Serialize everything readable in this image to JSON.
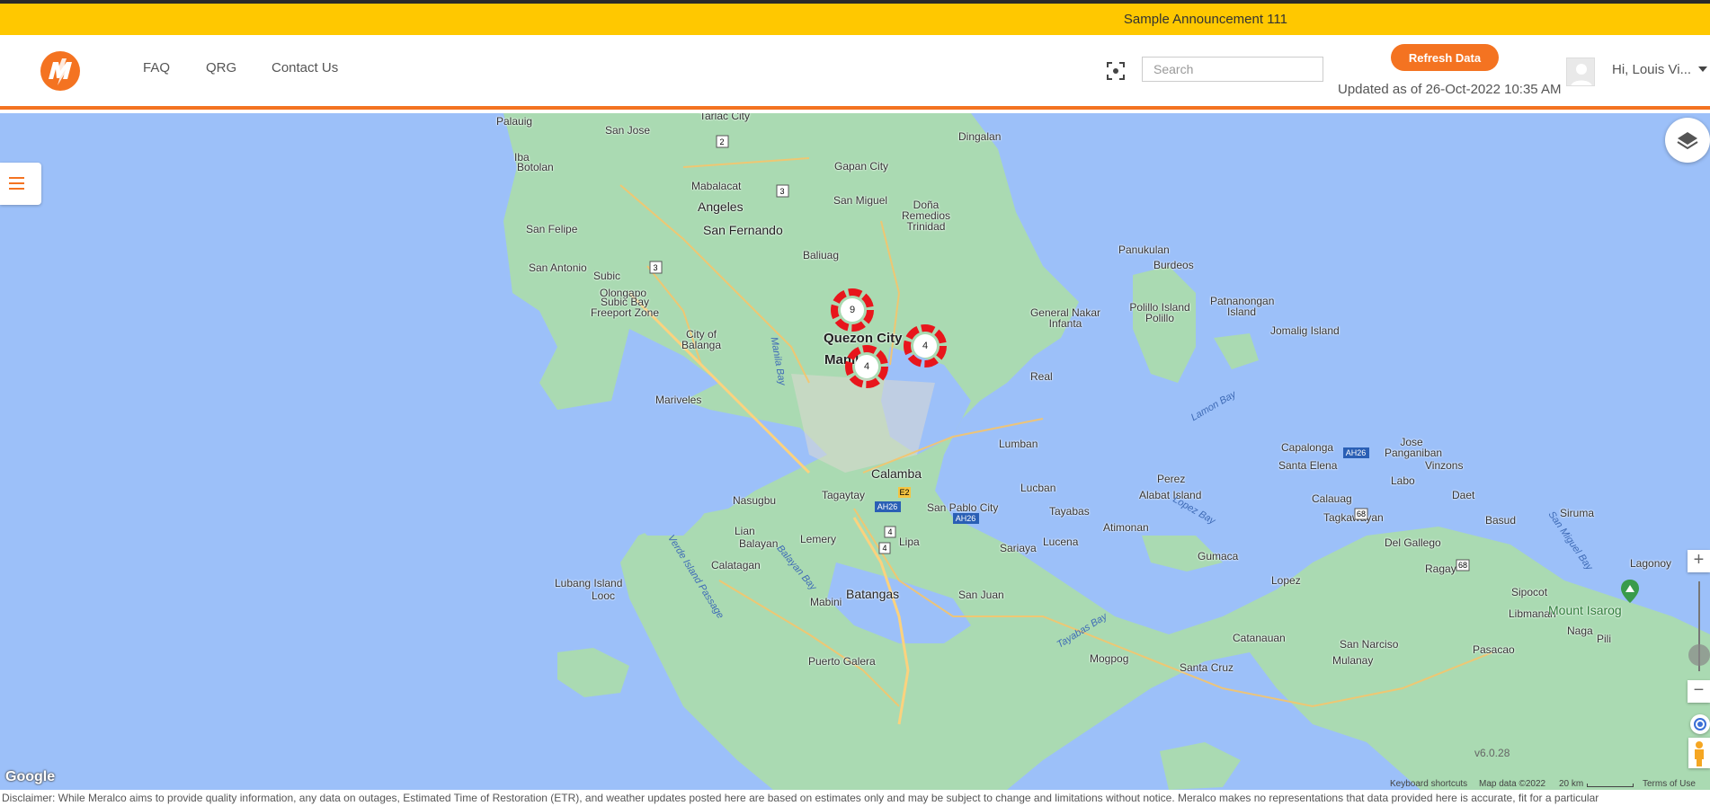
{
  "announcement": {
    "text": "Sample Announcement 111"
  },
  "header": {
    "nav": [
      {
        "label": "FAQ"
      },
      {
        "label": "QRG"
      },
      {
        "label": "Contact Us"
      }
    ],
    "search_placeholder": "Search",
    "refresh_label": "Refresh Data",
    "updated_text": "Updated as of 26-Oct-2022 10:35 AM",
    "user_greeting": "Hi, Louis Vi..."
  },
  "colors": {
    "brand_orange": "#f47321",
    "announcement_yellow": "#ffc800",
    "water": "#9cc0f9",
    "land": "#aadab2",
    "cluster_red": "#e8161c"
  },
  "map": {
    "labels": {
      "palauig": "Palauig",
      "tarlac": "Tarlac City",
      "san_jose": "San Jose",
      "dingalan": "Dingalan",
      "iba": "Iba",
      "botolan": "Botolan",
      "gapan": "Gapan City",
      "mabalacat": "Mabalacat",
      "angeles": "Angeles",
      "san_fernando": "San Fernando",
      "san_miguel": "San Miguel",
      "dona_remedios": "Doña Remedios Trinidad",
      "san_felipe": "San Felipe",
      "san_antonio": "San Antonio",
      "subic": "Subic",
      "olongapo": "Olongapo",
      "subic_bay": "Subic Bay Freeport Zone",
      "baliuag": "Baliuag",
      "panukulan": "Panukulan",
      "burdeos": "Burdeos",
      "polillo": "Polillo Island Polillo",
      "patnanongan": "Patnanongan Island",
      "jomalig": "Jomalig Island",
      "general_nakar": "General Nakar Infanta",
      "balanga": "City of Balanga",
      "quezon_city": "Quezon City",
      "manila": "Manila",
      "manila_bay": "Manila Bay",
      "real": "Real",
      "mariveles": "Mariveles",
      "lamon_bay": "Lamon Bay",
      "lumban": "Lumban",
      "calamba": "Calamba",
      "capalonga": "Capalonga",
      "jose_panganiban": "Jose Panganiban",
      "santa_elena": "Santa Elena",
      "vinzons": "Vinzons",
      "labo": "Labo",
      "daet": "Daet",
      "perez": "Perez",
      "alabat": "Alabat Island",
      "nasugbu": "Nasugbu",
      "tagaytay": "Tagaytay",
      "lucban": "Lucban",
      "calauag": "Calauag",
      "tagkawayan": "Tagkawayan",
      "basud": "Basud",
      "siruma": "Siruma",
      "san_pablo": "San Pablo City",
      "tayabas": "Tayabas",
      "lopez_bay": "Lopez Bay",
      "del_gallego": "Del Gallego",
      "lian": "Lian",
      "san_miguel_bay": "San Miguel Bay",
      "lagonoy": "Lagonoy",
      "balayan": "Balayan",
      "lemery": "Lemery",
      "lipa": "Lipa",
      "sariaya": "Sariaya",
      "lucena": "Lucena",
      "atimonan": "Atimonan",
      "calatagan": "Calatagan",
      "balayan_bay": "Balayan Bay",
      "gumaca": "Gumaca",
      "ragay": "Ragay",
      "sipocot": "Sipocot",
      "verde": "Verde Island Passage",
      "lubang": "Lubang Island",
      "looc": "Looc",
      "lopez": "Lopez",
      "libmanan": "Libmanan",
      "mount_isarog": "Mount Isarog",
      "batangas": "Batangas",
      "mabini": "Mabini",
      "san_juan": "San Juan",
      "naga": "Naga",
      "pili": "Pili",
      "tayabas_bay": "Tayabas Bay",
      "catanauan": "Catanauan",
      "san_narciso": "San Narciso",
      "pasacao": "Pasacao",
      "mulanay": "Mulanay",
      "puerto_galera": "Puerto Galera",
      "mogpog": "Mogpog",
      "santa_cruz": "Santa Cruz"
    },
    "shields": {
      "r2": "2",
      "r3a": "3",
      "r3b": "3",
      "ah26a": "AH26",
      "ah26b": "AH26",
      "ah26c": "AH26",
      "e2": "E2",
      "r4a": "4",
      "r4b": "4",
      "r68a": "68",
      "r68b": "68"
    },
    "clusters": [
      {
        "count": "9"
      },
      {
        "count": "4"
      },
      {
        "count": "4"
      }
    ]
  },
  "map_controls": {
    "zoom_in": "+",
    "zoom_out": "−",
    "zoom_level_fraction": 0.7,
    "version": "v6.0.28",
    "google": "Google",
    "keyboard_shortcuts": "Keyboard shortcuts",
    "map_data": "Map data ©2022",
    "scale": "20 km",
    "terms": "Terms of Use"
  },
  "disclaimer": "Disclaimer: While Meralco aims to provide quality information, any data on outages, Estimated Time of Restoration (ETR), and weather updates posted here are based on estimates only and may be subject to change and limitations without notice. Meralco makes no representations that data provided here is accurate, fit for a particular"
}
